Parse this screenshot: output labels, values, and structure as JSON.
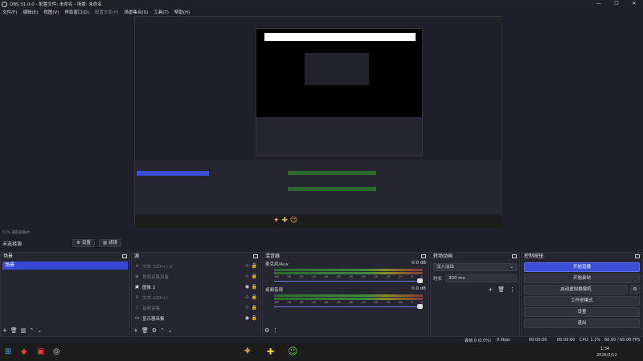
{
  "app": {
    "title": "OBS 31.0.0 - 配置文件: 未命名 - 场景: 未命名"
  },
  "menu": [
    "文件(F)",
    "编辑(E)",
    "视图(V)",
    "停靠窗口(D)",
    "配置文件(P)",
    "场景集合(S)",
    "工具(T)",
    "帮助(H)"
  ],
  "menu_dim": [
    false,
    false,
    false,
    false,
    true,
    false,
    false,
    false
  ],
  "preview_bar": {
    "status_mini": "57%    捕获屏幕中",
    "no_source": "未选择源",
    "settings": "设置",
    "filters": "滤镜"
  },
  "scenes": {
    "title": "场景",
    "items": [
      "场景"
    ]
  },
  "sources": {
    "title": "源",
    "items": [
      {
        "label": "文本 (GDI+) 2",
        "icon": "text-icon",
        "disabled": true
      },
      {
        "label": "视频采集设备",
        "icon": "camera-icon",
        "disabled": true
      },
      {
        "label": "图像 2",
        "icon": "image-icon",
        "disabled": false
      },
      {
        "label": "文本 (GDI+)",
        "icon": "text-icon",
        "disabled": true
      },
      {
        "label": "音频采集",
        "icon": "audio-icon",
        "disabled": true
      },
      {
        "label": "显示器采集",
        "icon": "monitor-icon",
        "disabled": false
      }
    ]
  },
  "mixer": {
    "title": "混音器",
    "channels": [
      {
        "name": "麦克风/Aux",
        "db": "0.0 dB"
      },
      {
        "name": "桌面音频",
        "db": "0.0 dB"
      }
    ],
    "ticks": [
      "-60",
      "-55",
      "-50",
      "-45",
      "-40",
      "-35",
      "-30",
      "-25",
      "-20",
      "-15",
      "-10",
      "-5",
      "0"
    ]
  },
  "transitions": {
    "title": "转场动画",
    "selected": "淡入淡出",
    "duration_label": "时长",
    "duration_value": "300 ms"
  },
  "controls": {
    "title": "控制按钮",
    "buttons": [
      "开始直播",
      "开始录制",
      "启动虚拟摄像机",
      "工作室模式",
      "设置",
      "退出"
    ]
  },
  "status": {
    "frames": "丢帧 0 (0.0%)",
    "kbps": "0 kbps",
    "time1": "00:00:00",
    "time2": "00:00:00",
    "cpu": "CPU: 1.1%",
    "fps": "60.00 / 60.00 FPS"
  },
  "taskbar": {
    "time": "1:34",
    "date": "2026/2/12"
  },
  "colors": {
    "accent": "#3b4fd8",
    "panel": "#252631",
    "bg": "#1e1f29"
  }
}
